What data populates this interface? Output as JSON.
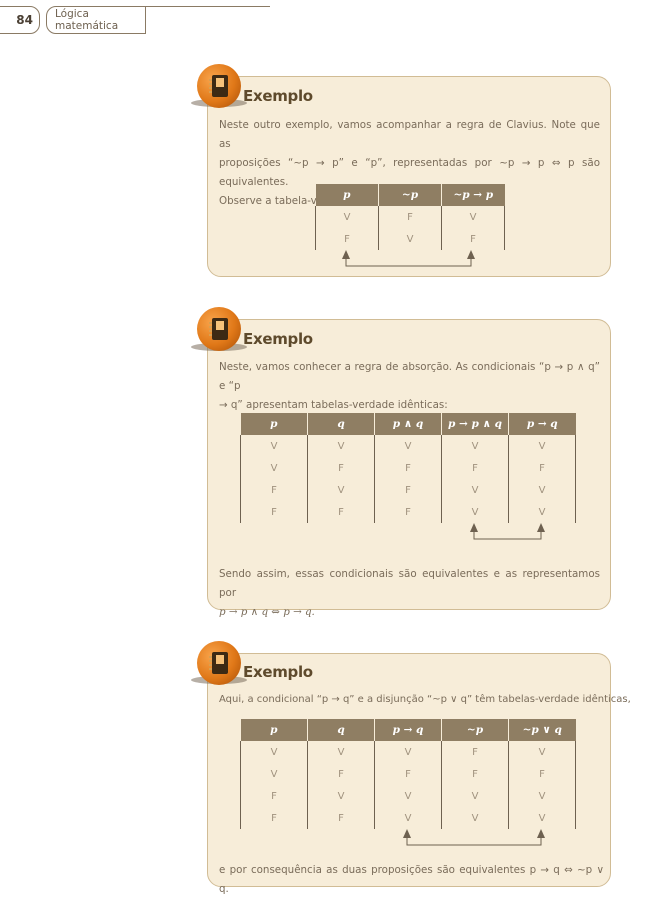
{
  "header": {
    "page_number": "84",
    "book_title": "Lógica matemática"
  },
  "examples": [
    {
      "title": "Exemplo",
      "text": [
        "Neste outro exemplo, vamos acompanhar a regra de Clavius. Note que as",
        "proposições “~p → p” e “p”, representadas por ~p → p ⇔ p são equivalentes.",
        "Observe a tabela-verdade:"
      ],
      "table": {
        "headers": [
          "p",
          "~p",
          "~p → p"
        ],
        "rows": [
          [
            "V",
            "F",
            "V"
          ],
          [
            "F",
            "V",
            "F"
          ]
        ]
      }
    },
    {
      "title": "Exemplo",
      "text": [
        "Neste, vamos conhecer a regra de absorção. As condicionais “p → p ∧ q” e “p",
        "→ q” apresentam tabelas-verdade idênticas:"
      ],
      "table": {
        "headers": [
          "p",
          "q",
          "p ∧ q",
          "p → p ∧ q",
          "p → q"
        ],
        "rows": [
          [
            "V",
            "V",
            "V",
            "V",
            "V"
          ],
          [
            "V",
            "F",
            "F",
            "F",
            "F"
          ],
          [
            "F",
            "V",
            "F",
            "V",
            "V"
          ],
          [
            "F",
            "F",
            "F",
            "V",
            "V"
          ]
        ]
      },
      "closing": [
        "Sendo assim, essas condicionais são equivalentes e as representamos por",
        "p → p ∧ q ⇔ p → q."
      ]
    },
    {
      "title": "Exemplo",
      "text": [
        "Aqui, a condicional “p → q” e a disjunção “~p ∨ q” têm tabelas-verdade idênticas,"
      ],
      "table": {
        "headers": [
          "p",
          "q",
          "p → q",
          "~p",
          "~p ∨ q"
        ],
        "rows": [
          [
            "V",
            "V",
            "V",
            "F",
            "V"
          ],
          [
            "V",
            "F",
            "F",
            "F",
            "F"
          ],
          [
            "F",
            "V",
            "V",
            "V",
            "V"
          ],
          [
            "F",
            "F",
            "V",
            "V",
            "V"
          ]
        ]
      },
      "closing": [
        "e por consequência as duas proposições são equivalentes p → q ⇔ ~p ∨ q."
      ]
    }
  ],
  "colors": {
    "box_bg": "#f7edd9",
    "box_border": "#d1bc95",
    "table_header": "#8f7e63",
    "badge": "#e07818"
  },
  "icons": {
    "badge": "book-icon"
  }
}
